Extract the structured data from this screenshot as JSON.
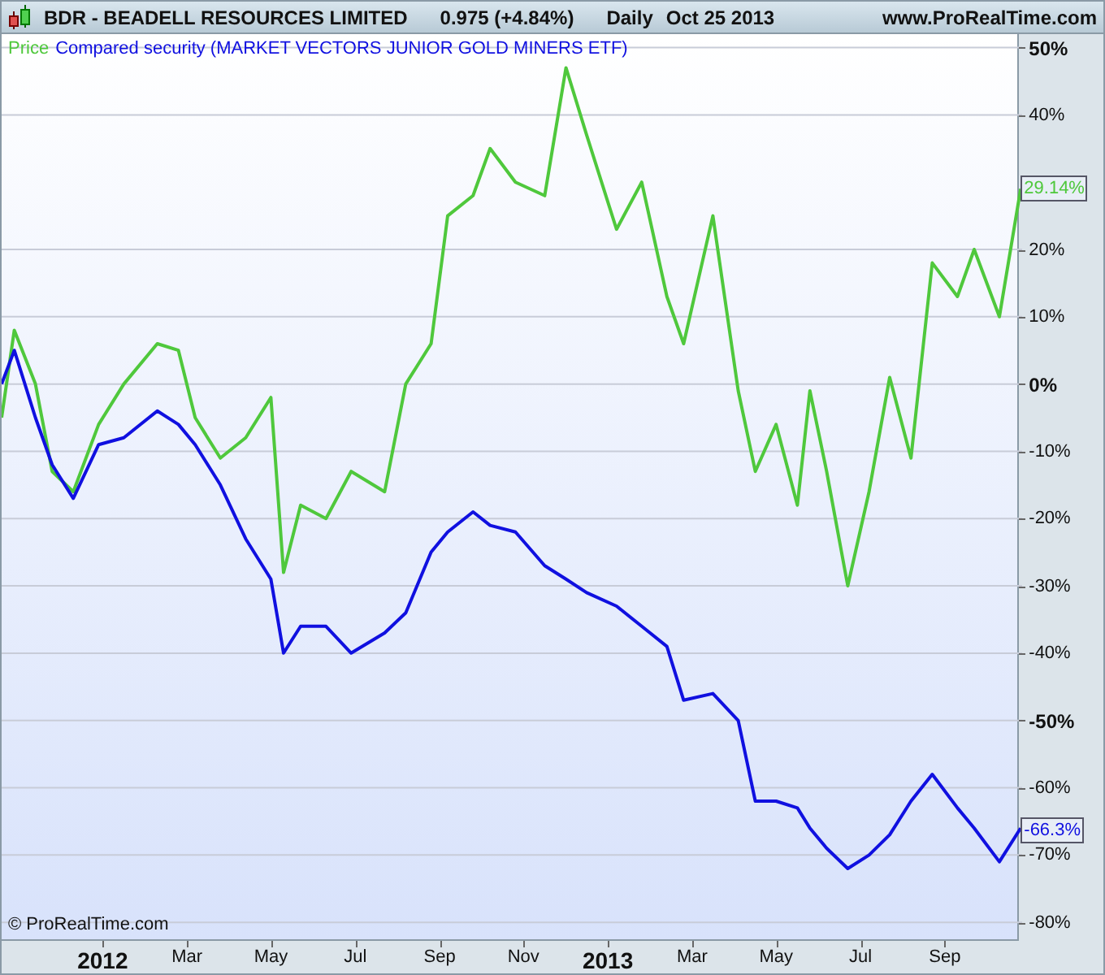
{
  "header": {
    "title": "BDR - BEADELL RESOURCES LIMITED",
    "quote": "0.975 (+4.84%)",
    "period": "Daily",
    "date": "Oct 25 2013",
    "site": "www.ProRealTime.com"
  },
  "chart": {
    "copyright": "© ProRealTime.com",
    "chart_data": {
      "type": "line",
      "x": [
        2011.8,
        2011.825,
        2011.867,
        2011.9,
        2011.942,
        2011.992,
        2012.042,
        2012.108,
        2012.15,
        2012.183,
        2012.233,
        2012.283,
        2012.333,
        2012.358,
        2012.392,
        2012.442,
        2012.492,
        2012.558,
        2012.6,
        2012.65,
        2012.683,
        2012.733,
        2012.767,
        2012.817,
        2012.875,
        2012.917,
        2012.958,
        2013.017,
        2013.067,
        2013.117,
        2013.15,
        2013.208,
        2013.258,
        2013.292,
        2013.333,
        2013.375,
        2013.4,
        2013.433,
        2013.475,
        2013.517,
        2013.558,
        2013.6,
        2013.642,
        2013.692,
        2013.725,
        2013.775,
        2013.817
      ],
      "series": [
        {
          "name": "Price",
          "color": "#4fc83c",
          "values": [
            -5,
            8,
            0,
            -13,
            -16,
            -6,
            0,
            6,
            5,
            -5,
            -11,
            -8,
            -2,
            -28,
            -18,
            -20,
            -13,
            -16,
            0,
            6,
            25,
            28,
            35,
            30,
            28,
            47,
            37,
            23,
            30,
            13,
            6,
            25,
            -1,
            -13,
            -6,
            -18,
            -1,
            -13,
            -30,
            -16,
            1,
            -11,
            18,
            13,
            20,
            10,
            29
          ]
        },
        {
          "name": "Compared security (MARKET VECTORS JUNIOR GOLD MINERS ETF)",
          "color": "#1010e0",
          "values": [
            0,
            5,
            -5,
            -12,
            -17,
            -9,
            -8,
            -4,
            -6,
            -9,
            -15,
            -23,
            -29,
            -40,
            -36,
            -36,
            -40,
            -37,
            -34,
            -25,
            -22,
            -19,
            -21,
            -22,
            -27,
            -29,
            -31,
            -33,
            -36,
            -39,
            -47,
            -46,
            -50,
            -62,
            -62,
            -63,
            -66,
            -69,
            -72,
            -70,
            -67,
            -62,
            -58,
            -63,
            -66,
            -71,
            -66
          ]
        }
      ],
      "grid": true,
      "xlim": [
        2011.8,
        2013.82
      ],
      "ylim": [
        -83,
        52
      ],
      "xticks": [
        {
          "value": 2012,
          "label": "2012"
        },
        {
          "value": 2012.167,
          "label": "Mar"
        },
        {
          "value": 2012.333,
          "label": "May"
        },
        {
          "value": 2012.5,
          "label": "Jul"
        },
        {
          "value": 2012.667,
          "label": "Sep"
        },
        {
          "value": 2012.833,
          "label": "Nov"
        },
        {
          "value": 2013,
          "label": "2013"
        },
        {
          "value": 2013.167,
          "label": "Mar"
        },
        {
          "value": 2013.333,
          "label": "May"
        },
        {
          "value": 2013.5,
          "label": "Jul"
        },
        {
          "value": 2013.667,
          "label": "Sep"
        }
      ],
      "yticks": [
        {
          "value": 50,
          "label": "50%"
        },
        {
          "value": 40,
          "label": "40%"
        },
        {
          "value": 20,
          "label": "20%"
        },
        {
          "value": 10,
          "label": "10%"
        },
        {
          "value": 0,
          "label": "0%"
        },
        {
          "value": -10,
          "label": "-10%"
        },
        {
          "value": -20,
          "label": "-20%"
        },
        {
          "value": -30,
          "label": "-30%"
        },
        {
          "value": -40,
          "label": "-40%"
        },
        {
          "value": -50,
          "label": "-50%"
        },
        {
          "value": -60,
          "label": "-60%"
        },
        {
          "value": -70,
          "label": "-70%"
        },
        {
          "value": -80,
          "label": "-80%"
        }
      ],
      "annotations": [
        {
          "x": 2013.82,
          "y": 29.14,
          "text": "29.14%"
        },
        {
          "x": 2013.82,
          "y": -66.3,
          "text": "-66.3%"
        }
      ]
    }
  }
}
